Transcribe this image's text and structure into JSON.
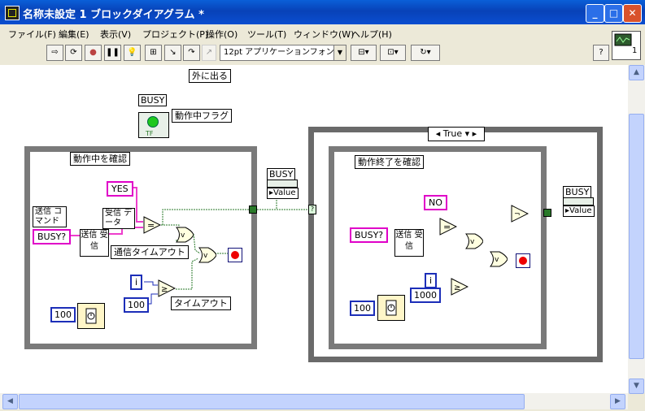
{
  "window": {
    "title": "名称未設定 1 ブロックダイアグラム *"
  },
  "menu": [
    "ファイル(F)",
    "編集(E)",
    "表示(V)",
    "プロジェクト(P)",
    "操作(O)",
    "ツール(T)",
    "ウィンドウ(W)",
    "ヘルプ(H)"
  ],
  "toolbar": {
    "font": "12pt アプリケーションフォント",
    "help": "?",
    "ctx_number": "1"
  },
  "diagram": {
    "outside_label": "外に出る",
    "busy_label": "BUSY",
    "busy_tf": "TF",
    "busy_flag_label": "動作中フラグ",
    "left_loop_label": "動作中を確認",
    "yes_const": "YES",
    "send_cmd_label": "送信 コマンド",
    "recv_data_label": "受信 データ",
    "busy_q_left": "BUSY?",
    "subvi_label": "送信 受信",
    "comm_timeout_label": "通信タイムアウト",
    "i_left": "i",
    "timeout_left": "100",
    "timeout_label": "タイムアウト",
    "wait_left": "100",
    "busy_ind_label": "BUSY",
    "value_label": "Value",
    "case_selector": "True",
    "right_loop_label": "動作終了を確認",
    "no_const": "NO",
    "busy_q_right": "BUSY?",
    "i_right": "i",
    "timeout_right": "1000",
    "wait_right": "100",
    "busy_ind_label_right": "BUSY",
    "value_label_right": "Value",
    "tunnel_q": "?"
  }
}
